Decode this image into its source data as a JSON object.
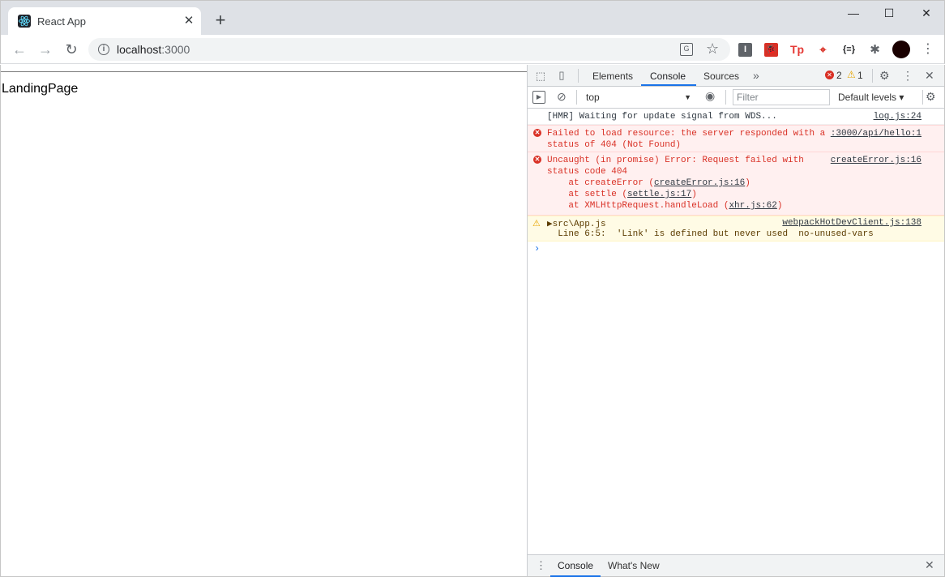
{
  "browser": {
    "tab_title": "React App",
    "tab_close": "✕",
    "new_tab": "+",
    "window_controls": {
      "minimize": "—",
      "maximize": "☐",
      "close": "✕"
    },
    "url_host": "localhost",
    "url_port": ":3000",
    "extensions": [
      "I",
      "🐞",
      "Tp",
      "⌖",
      "{≡}",
      "✱"
    ],
    "icons": [
      "back-arrow-icon",
      "forward-arrow-icon",
      "reload-icon",
      "info-icon",
      "translate-icon",
      "star-icon",
      "extensions-puzzle-icon",
      "profile-avatar",
      "menu-kebab-icon"
    ]
  },
  "page": {
    "text": "LandingPage"
  },
  "devtools": {
    "tabs": {
      "elements": "Elements",
      "console": "Console",
      "sources": "Sources",
      "more": "»"
    },
    "error_count": "2",
    "warning_count": "1",
    "context": "top",
    "filter_placeholder": "Filter",
    "levels": "Default levels ▾",
    "console_messages": {
      "log": {
        "text": "[HMR] Waiting for update signal from WDS...",
        "source": "log.js:24"
      },
      "error1": {
        "line1": "Failed to load resource: the server responded with a",
        "line2": "status of 404 (Not Found)",
        "source": ":3000/api/hello:1"
      },
      "error2": {
        "line1": "Uncaught (in promise) Error: Request failed with",
        "line2": "status code 404",
        "stack1_prefix": "    at createError (",
        "stack1_link": "createError.js:16",
        "stack2_prefix": "    at settle (",
        "stack2_link": "settle.js:17",
        "stack3_prefix": "    at XMLHttpRequest.handleLoad (",
        "stack3_link": "xhr.js:62",
        "close_paren": ")",
        "source": "createError.js:16"
      },
      "warning": {
        "line1": "▶src\\App.js",
        "line2": "  Line 6:5:  'Link' is defined but never used  no-unused-vars",
        "source": "webpackHotDevClient.js:138"
      }
    },
    "prompt": "›",
    "drawer": {
      "console": "Console",
      "whats_new": "What's New"
    }
  },
  "colors": {
    "accent": "#1a73e8",
    "error": "#d93025",
    "warning": "#e8a500",
    "error_bg": "#fff0f0",
    "warning_bg": "#fffbe5"
  }
}
